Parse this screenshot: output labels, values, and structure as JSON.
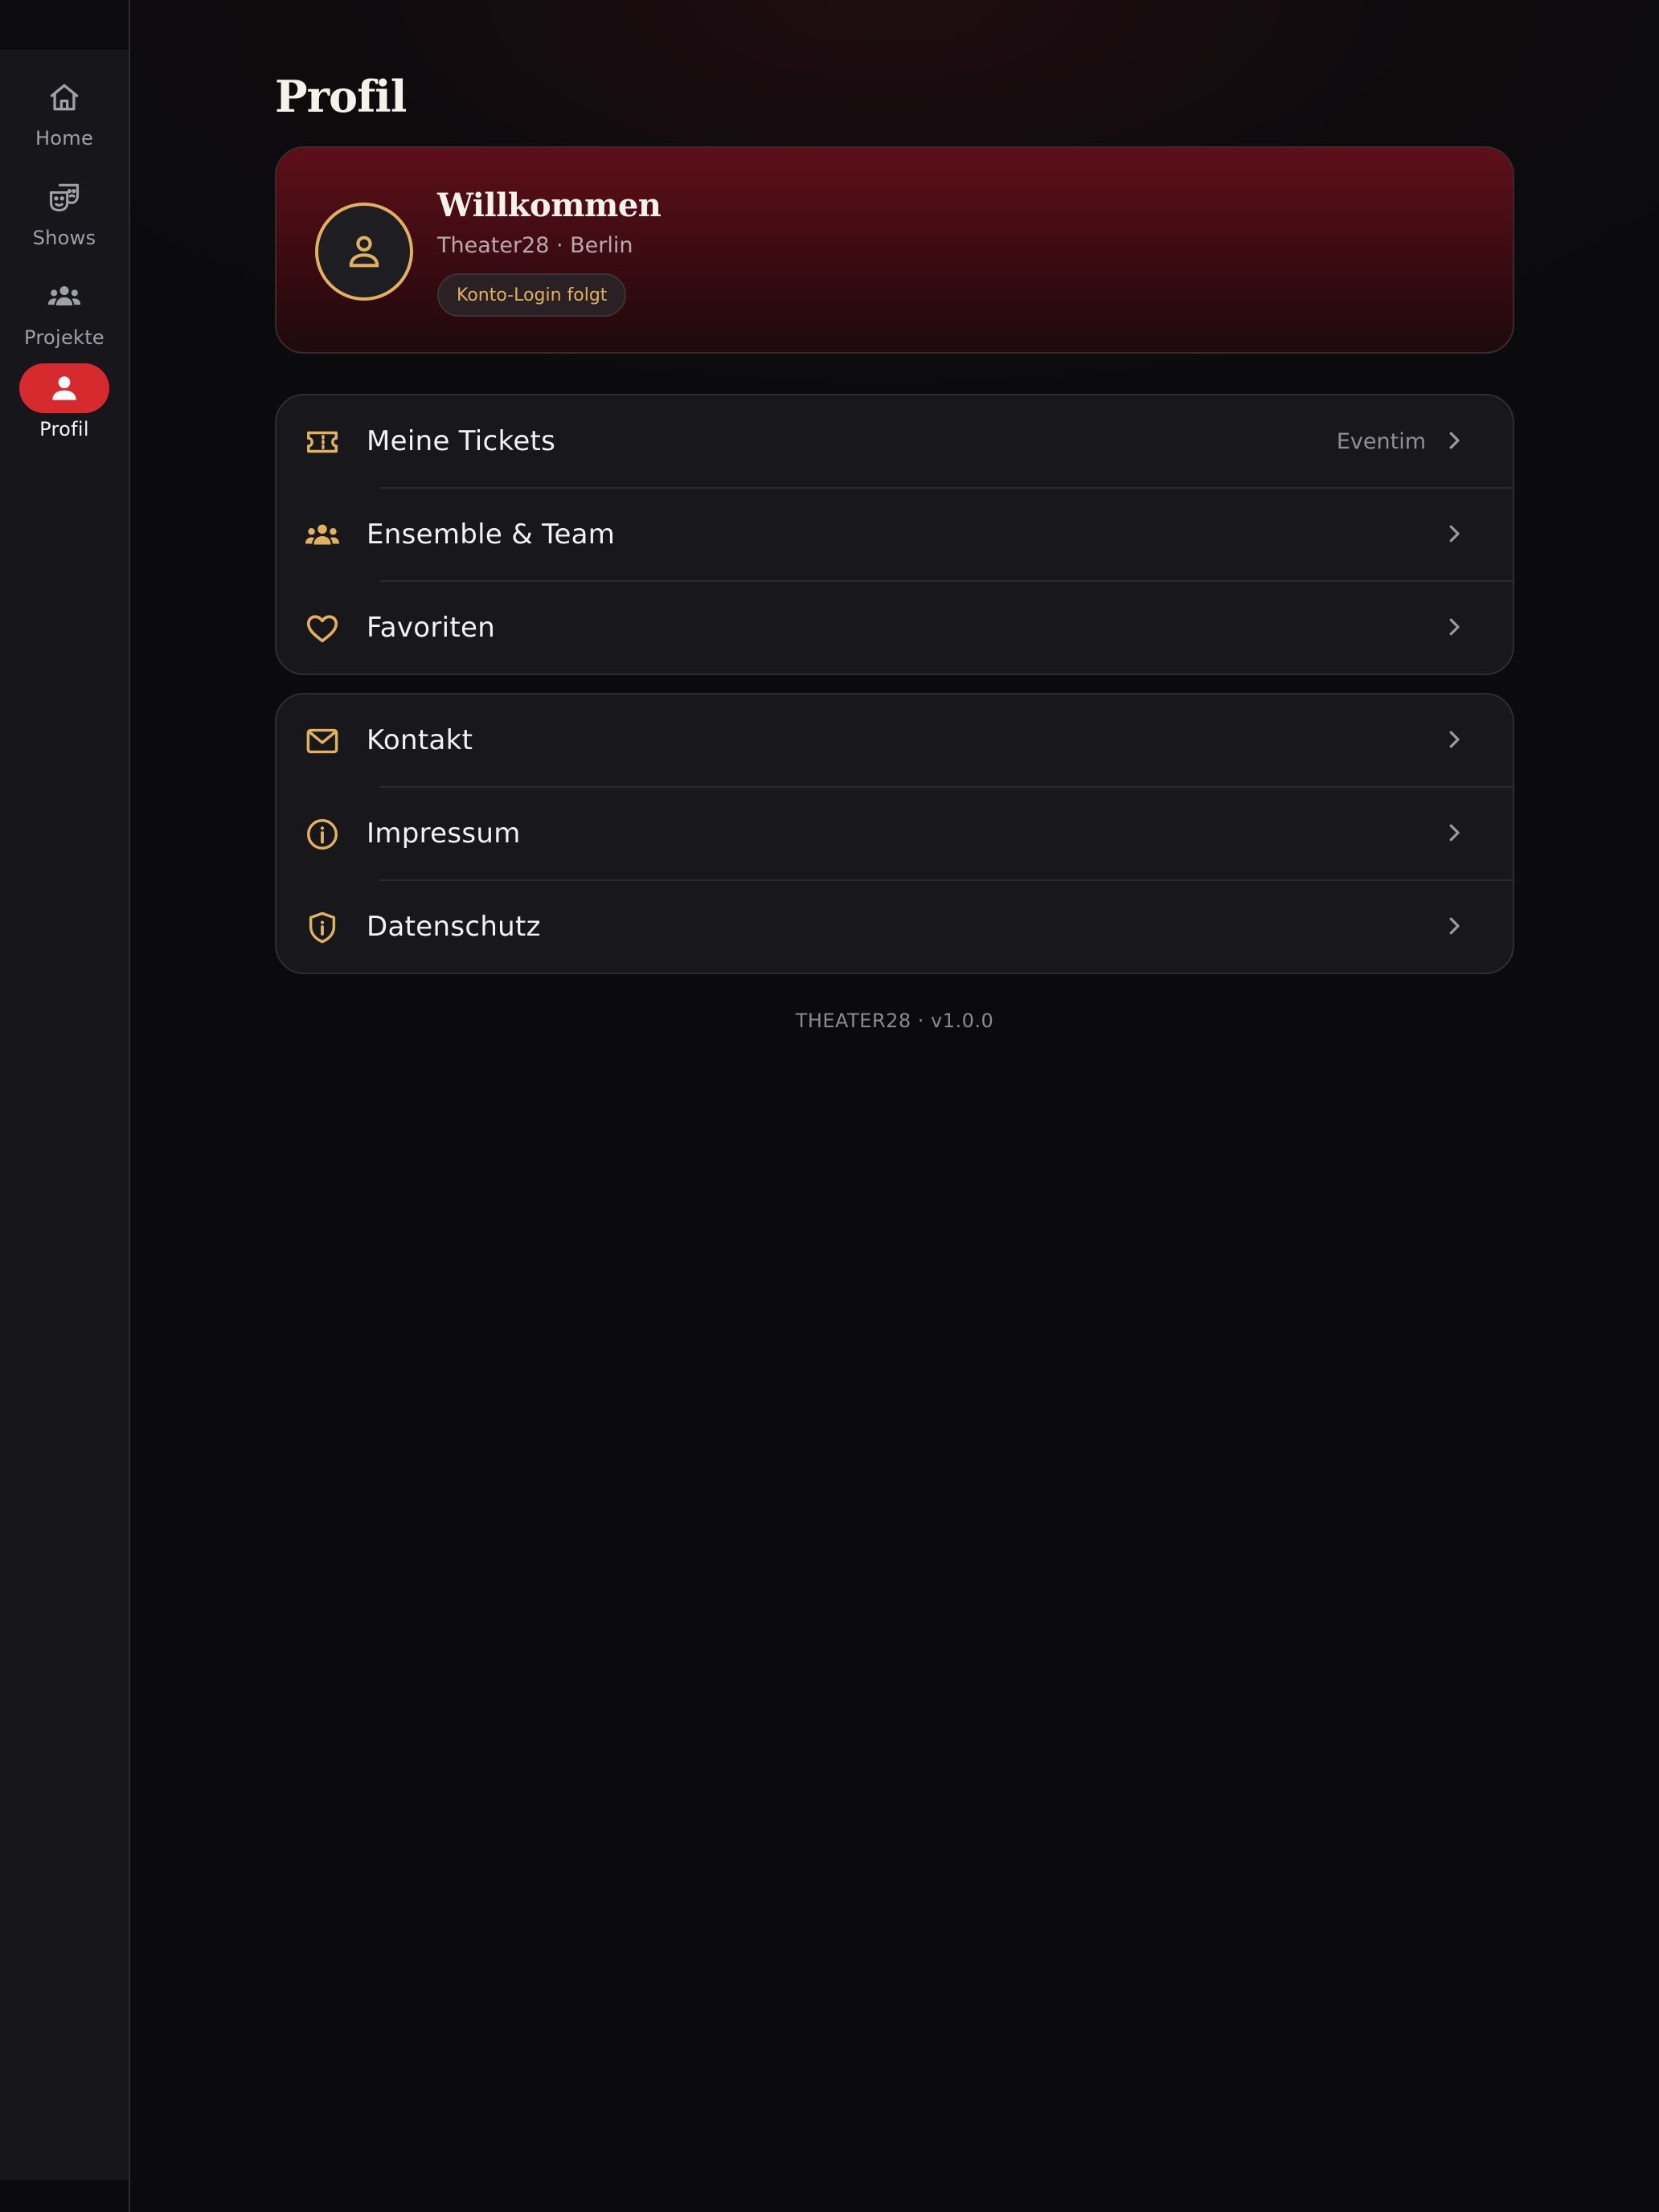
{
  "sidebar": {
    "items": [
      {
        "label": "Home",
        "icon": "home-icon",
        "active": false
      },
      {
        "label": "Shows",
        "icon": "theater-masks-icon",
        "active": false
      },
      {
        "label": "Projekte",
        "icon": "group-icon",
        "active": false
      },
      {
        "label": "Profil",
        "icon": "person-icon",
        "active": true
      }
    ]
  },
  "header": {
    "title": "Profil"
  },
  "profile": {
    "title": "Willkommen",
    "subtitle": "Theater28 · Berlin",
    "badge": "Konto-Login folgt",
    "avatar_icon": "person-outline-icon"
  },
  "groups": [
    {
      "rows": [
        {
          "label": "Meine Tickets",
          "trailing": "Eventim",
          "icon": "ticket-icon"
        },
        {
          "label": "Ensemble & Team",
          "trailing": "",
          "icon": "group-icon"
        },
        {
          "label": "Favoriten",
          "trailing": "",
          "icon": "heart-icon"
        }
      ]
    },
    {
      "rows": [
        {
          "label": "Kontakt",
          "trailing": "",
          "icon": "mail-icon"
        },
        {
          "label": "Impressum",
          "trailing": "",
          "icon": "info-icon"
        },
        {
          "label": "Datenschutz",
          "trailing": "",
          "icon": "shield-info-icon"
        }
      ]
    }
  ],
  "footer": {
    "version": "THEATER28 · v1.0.0"
  },
  "colors": {
    "accent": "#d62a2f",
    "gold": "#e2b15e",
    "hero_top": "#5e0f18",
    "card": "#18181c",
    "background": "#0b0b0d"
  }
}
